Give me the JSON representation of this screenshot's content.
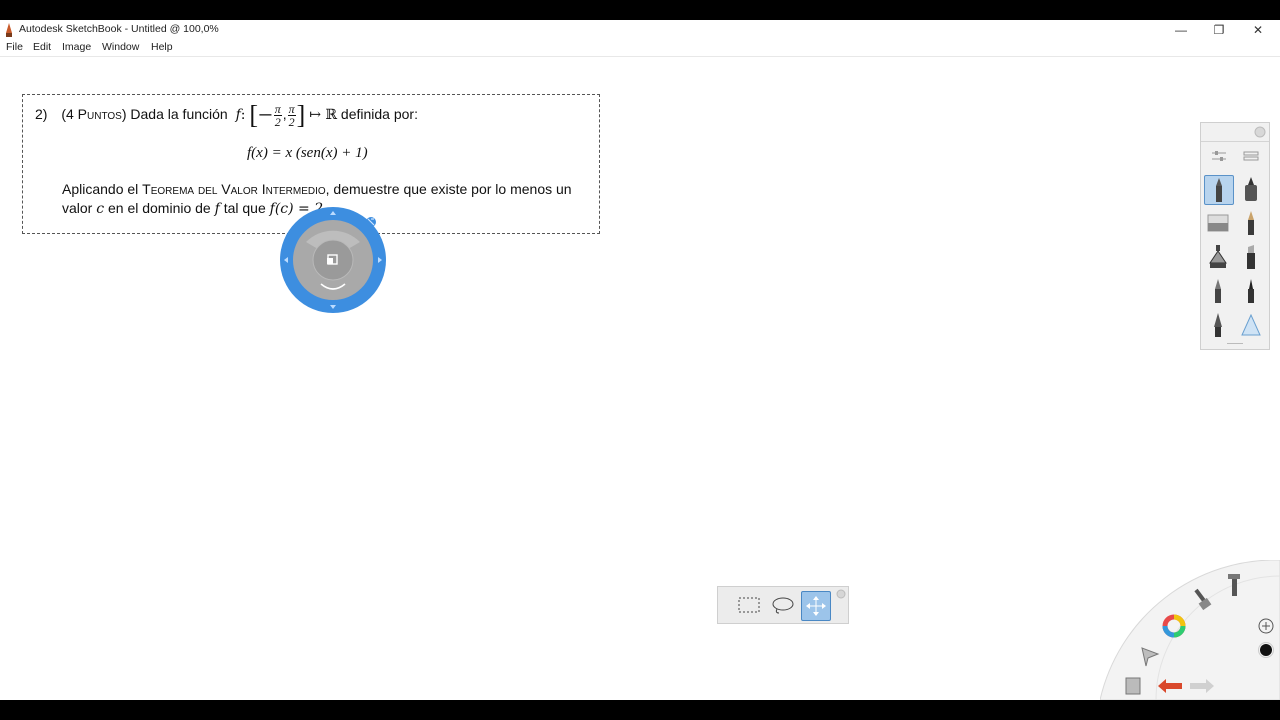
{
  "window": {
    "title": "Autodesk SketchBook - Untitled @ 100,0%",
    "minimize": "—",
    "restore": "❐",
    "close": "✕"
  },
  "menu": [
    "File",
    "Edit",
    "Image",
    "Window",
    "Help"
  ],
  "problem": {
    "number": "2)",
    "points": "(4 Puntos)",
    "intro": "Dada la función",
    "func_name": "f",
    "domain_left": "[−",
    "pi": "π",
    "two": "2",
    "comma": ",",
    "domain_right": "]",
    "maps_to": "↦ ℝ",
    "definida": "definida por:",
    "formula": "f(x) = x (sen(x) + 1)",
    "line1_a": "Aplicando el",
    "theorem": "Teorema del Valor Intermedio",
    "line1_b": ", demuestre que existe por lo menos un",
    "line2_a": "valor",
    "var_c": "c",
    "line2_b": "en el dominio de",
    "var_f": "f",
    "line2_c": "tal que",
    "cond": "f(c) = 2"
  },
  "colors": {
    "puck_ring": "#3d8ee0",
    "puck_center": "#a9a9a9",
    "selected_tool": "#b8d4ee",
    "undo_arrow": "#d9482b"
  },
  "icons": {
    "brush_panel": [
      "brush-properties-icon",
      "brush-library-icon",
      "ballpoint-pen-icon",
      "marker-icon",
      "eraser-icon",
      "pencil-icon",
      "airbrush-icon",
      "chisel-marker-icon",
      "fine-pen-icon",
      "technical-pen-icon",
      "ink-pen-icon",
      "smudge-icon"
    ],
    "select_bar": [
      "rectangle-select-icon",
      "lasso-select-icon",
      "move-transform-icon"
    ],
    "lagoon": [
      "color-wheel-icon",
      "brush-icon",
      "pen-tool-icon",
      "select-tool-icon",
      "layer-icon",
      "undo-icon",
      "redo-icon",
      "transform-icon",
      "black-color-icon"
    ]
  }
}
